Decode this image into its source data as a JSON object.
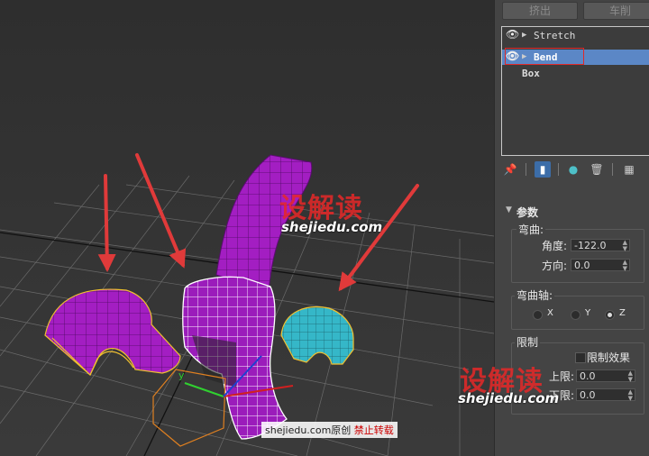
{
  "toolbar": {
    "extrude": "挤出",
    "lathe": "车削"
  },
  "modifier_stack": {
    "items": [
      {
        "name": "Stretch",
        "selected": false
      },
      {
        "name": "Bend",
        "selected": true
      }
    ],
    "base_object": "Box"
  },
  "parameters": {
    "rollout_title": "参数",
    "bend_label": "弯曲:",
    "angle_label": "角度:",
    "angle_value": "-122.0",
    "direction_label": "方向:",
    "direction_value": "0.0",
    "axis_label": "弯曲轴:",
    "axis_x": "X",
    "axis_y": "Y",
    "axis_z": "Z",
    "selected_axis": "Z",
    "limits_label": "限制",
    "limit_effect_label": "限制效果",
    "upper_label": "上限:",
    "upper_value": "0.0",
    "lower_label": "下限:",
    "lower_value": "0.0"
  },
  "watermarks": {
    "brand": "设解读",
    "url": "shejiedu.com",
    "credit_site": "shejiedu.com原创",
    "credit_note": "禁止转载"
  },
  "colors": {
    "selection": "#5b87c6",
    "highlight_box": "#e02828",
    "magenta_object": "#a31ec2",
    "cyan_object": "#35b7c8",
    "arrow": "#e03a3a"
  }
}
